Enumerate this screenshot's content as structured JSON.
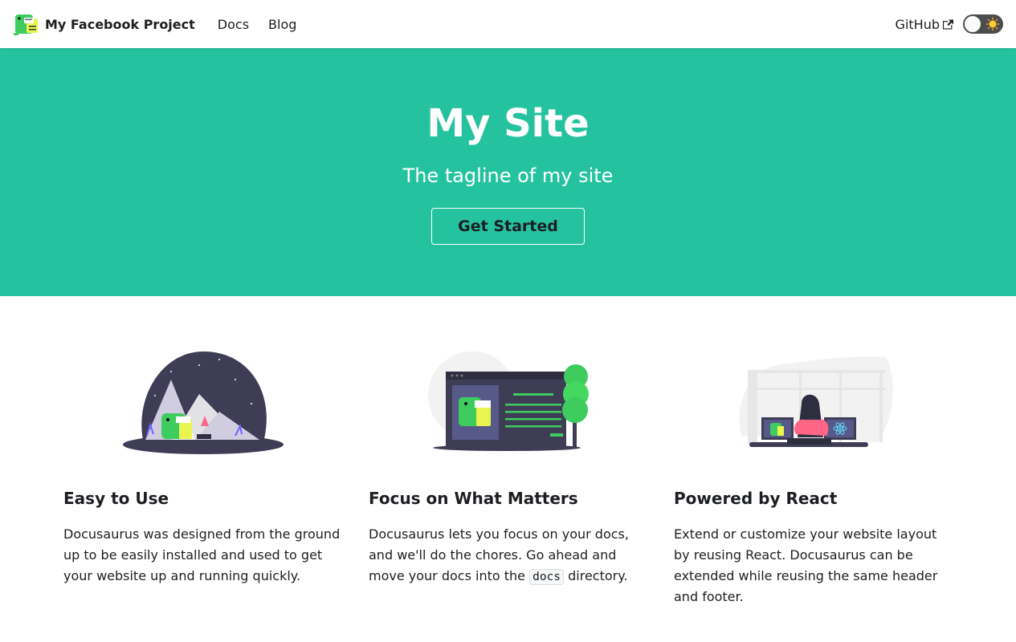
{
  "navbar": {
    "brand_title": "My Facebook Project",
    "links": [
      "Docs",
      "Blog"
    ],
    "github_label": "GitHub",
    "theme": "light"
  },
  "hero": {
    "title": "My Site",
    "tagline": "The tagline of my site",
    "button_label": "Get Started",
    "background": "#25c2a0"
  },
  "features": [
    {
      "title": "Easy to Use",
      "description": "Docusaurus was designed from the ground up to be easily installed and used to get your website up and running quickly.",
      "image_icon": "mountain-dino-illustration"
    },
    {
      "title": "Focus on What Matters",
      "description_before": "Docusaurus lets you focus on your docs, and we'll do the chores. Go ahead and move your docs into the",
      "code": "docs",
      "description_after": "directory.",
      "image_icon": "docs-window-dino-illustration"
    },
    {
      "title": "Powered by React",
      "description": "Extend or customize your website layout by reusing React. Docusaurus can be extended while reusing the same header and footer.",
      "image_icon": "react-desk-illustration"
    }
  ]
}
